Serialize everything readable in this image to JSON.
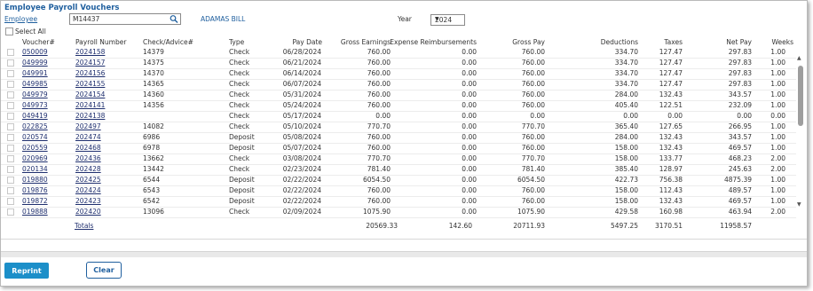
{
  "page": {
    "title": "Employee Payroll Vouchers",
    "employee_label": "Employee",
    "employee_id": "M14437",
    "employee_name": "ADAMAS BILL",
    "year_label": "Year",
    "year_value": "2024",
    "select_all_label": "Select All"
  },
  "columns": [
    "Voucher#",
    "Payroll Number",
    "Check/Advice#",
    "Type",
    "Pay Date",
    "Gross Earnings",
    "Expense Reimbursements",
    "Gross Pay",
    "Deductions",
    "Taxes",
    "Net Pay",
    "Weeks"
  ],
  "rows": [
    [
      "050009",
      "2024158",
      "14379",
      "Check",
      "06/28/2024",
      "760.00",
      "0.00",
      "760.00",
      "334.70",
      "127.47",
      "297.83",
      "1.00"
    ],
    [
      "049999",
      "2024157",
      "14375",
      "Check",
      "06/21/2024",
      "760.00",
      "0.00",
      "760.00",
      "334.70",
      "127.47",
      "297.83",
      "1.00"
    ],
    [
      "049991",
      "2024156",
      "14370",
      "Check",
      "06/14/2024",
      "760.00",
      "0.00",
      "760.00",
      "334.70",
      "127.47",
      "297.83",
      "1.00"
    ],
    [
      "049985",
      "2024155",
      "14365",
      "Check",
      "06/07/2024",
      "760.00",
      "0.00",
      "760.00",
      "334.70",
      "127.47",
      "297.83",
      "1.00"
    ],
    [
      "049979",
      "2024154",
      "14360",
      "Check",
      "05/31/2024",
      "760.00",
      "0.00",
      "760.00",
      "284.00",
      "132.43",
      "343.57",
      "1.00"
    ],
    [
      "049973",
      "2024141",
      "14356",
      "Check",
      "05/24/2024",
      "760.00",
      "0.00",
      "760.00",
      "405.40",
      "122.51",
      "232.09",
      "1.00"
    ],
    [
      "049419",
      "2024138",
      "",
      "Check",
      "05/17/2024",
      "0.00",
      "0.00",
      "0.00",
      "0.00",
      "0.00",
      "0.00",
      "0.00"
    ],
    [
      "022825",
      "202497",
      "14082",
      "Check",
      "05/10/2024",
      "770.70",
      "0.00",
      "770.70",
      "365.40",
      "127.65",
      "266.95",
      "1.00"
    ],
    [
      "020574",
      "202474",
      "6986",
      "Deposit",
      "05/08/2024",
      "760.00",
      "0.00",
      "760.00",
      "284.00",
      "132.43",
      "343.57",
      "1.00"
    ],
    [
      "020559",
      "202468",
      "6978",
      "Deposit",
      "05/07/2024",
      "760.00",
      "0.00",
      "760.00",
      "158.00",
      "132.43",
      "469.57",
      "1.00"
    ],
    [
      "020969",
      "202436",
      "13662",
      "Check",
      "03/08/2024",
      "770.70",
      "0.00",
      "770.70",
      "158.00",
      "133.77",
      "468.23",
      "2.00"
    ],
    [
      "020134",
      "202428",
      "13442",
      "Check",
      "02/23/2024",
      "781.40",
      "0.00",
      "781.40",
      "385.40",
      "128.97",
      "245.63",
      "2.00"
    ],
    [
      "019880",
      "202425",
      "6544",
      "Deposit",
      "02/22/2024",
      "6054.50",
      "0.00",
      "6054.50",
      "422.73",
      "756.38",
      "4875.39",
      "1.00"
    ],
    [
      "019876",
      "202424",
      "6543",
      "Deposit",
      "02/22/2024",
      "760.00",
      "0.00",
      "760.00",
      "158.00",
      "112.43",
      "489.57",
      "1.00"
    ],
    [
      "019872",
      "202423",
      "6542",
      "Deposit",
      "02/22/2024",
      "760.00",
      "0.00",
      "760.00",
      "158.00",
      "132.43",
      "469.57",
      "1.00"
    ],
    [
      "019888",
      "202420",
      "13096",
      "Check",
      "02/09/2024",
      "1075.90",
      "0.00",
      "1075.90",
      "429.58",
      "160.98",
      "463.94",
      "2.00"
    ]
  ],
  "totals": {
    "label": "Totals",
    "gross_earnings": "20569.33",
    "expense_reimbursements": "142.60",
    "gross_pay": "20711.93",
    "deductions": "5497.25",
    "taxes": "3170.51",
    "net_pay": "11958.57"
  },
  "buttons": {
    "reprint": "Reprint",
    "clear": "Clear"
  },
  "icons": {
    "search": "search-icon",
    "year_dropdown": "chevron-down-icon"
  },
  "colors": {
    "title": "#1f5f9e",
    "primary_button": "#1c8fc9",
    "link": "#1f2f6e"
  }
}
